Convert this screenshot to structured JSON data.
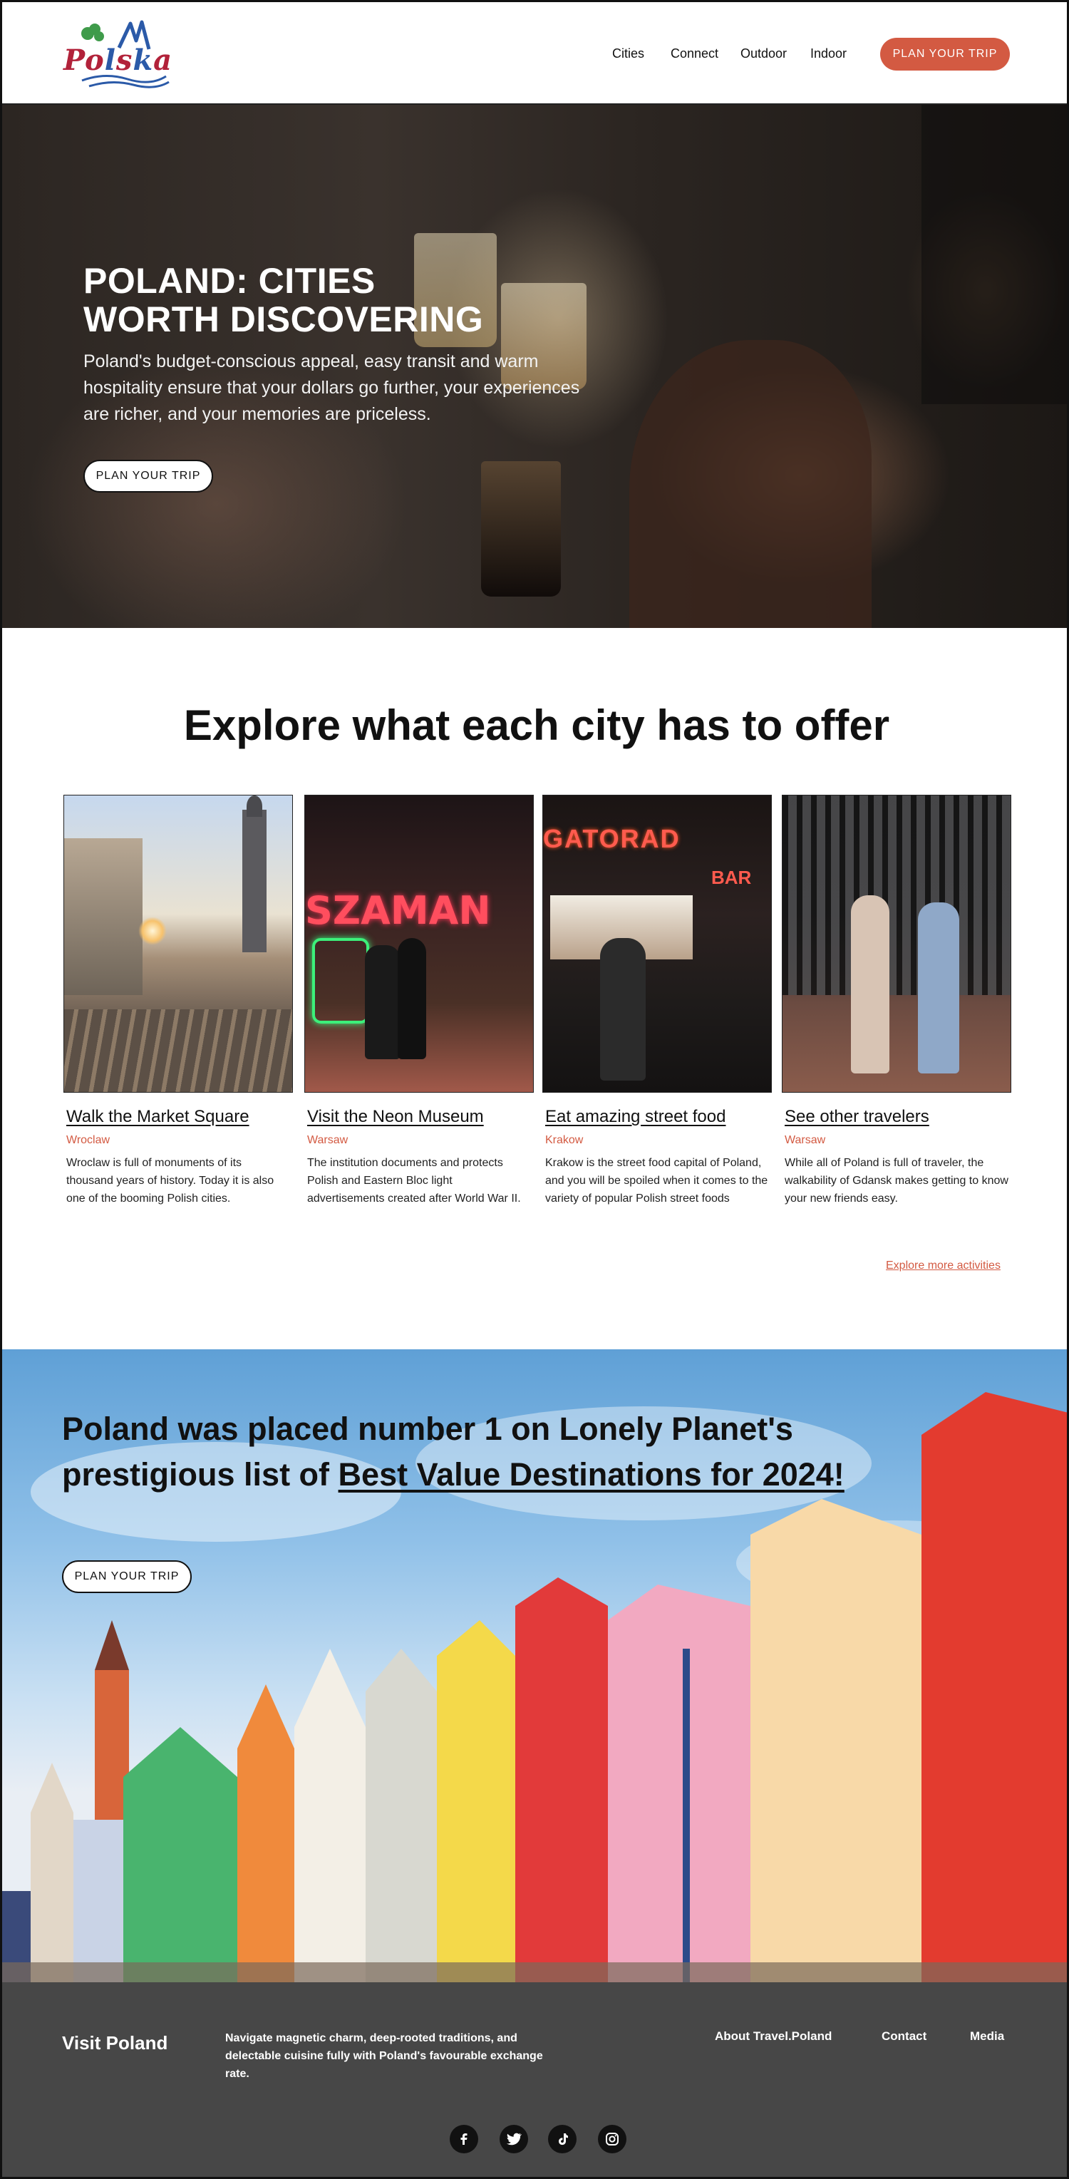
{
  "header": {
    "logo_text": "Polska",
    "nav": [
      "Cities",
      "Connect",
      "Outdoor",
      "Indoor"
    ],
    "cta": "PLAN YOUR TRIP"
  },
  "hero": {
    "title_line1": "POLAND: CITIES",
    "title_line2": "WORTH DISCOVERING",
    "text": "Poland's budget-conscious appeal, easy transit and warm hospitality ensure that your dollars go further, your experiences are richer, and your memories are priceless.",
    "cta": "PLAN YOUR TRIP"
  },
  "explore": {
    "title": "Explore what each city has to offer",
    "cards": [
      {
        "title": "Walk the Market Square",
        "city": "Wroclaw",
        "desc": "Wroclaw is full of monuments of its thousand years of history. Today it is also one of the booming Polish cities."
      },
      {
        "title": "Visit the Neon Museum",
        "city": "Warsaw",
        "desc": "The institution documents and protects Polish and Eastern Bloc light advertisements created after World War II."
      },
      {
        "title": "Eat amazing street food",
        "city": "Krakow",
        "desc": "Krakow is the street food capital of Poland, and you will be spoiled when it comes to the variety of popular Polish street foods"
      },
      {
        "title": "See other travelers",
        "city": "Warsaw",
        "desc": "While all of Poland is full of traveler, the walkability of Gdansk makes getting to know your new friends easy."
      }
    ],
    "more_link": "Explore more activities",
    "neon_sign": "SZAMAN",
    "food_sign": "GATORAD",
    "bar_sign": "BAR"
  },
  "banner": {
    "title_pre": "Poland was placed number 1 on Lonely Planet's prestigious list of ",
    "title_link": "Best Value Destinations for 2024!",
    "cta": "PLAN YOUR TRIP"
  },
  "footer": {
    "brand": "Visit Poland",
    "text": "Navigate magnetic charm, deep-rooted traditions, and delectable cuisine fully with Poland's favourable exchange rate.",
    "links": [
      "About Travel.Poland",
      "Contact",
      "Media"
    ],
    "social": [
      "facebook-icon",
      "twitter-icon",
      "tiktok-icon",
      "instagram-icon"
    ]
  },
  "colors": {
    "accent": "#d35a42",
    "footer_bg": "#474747"
  }
}
